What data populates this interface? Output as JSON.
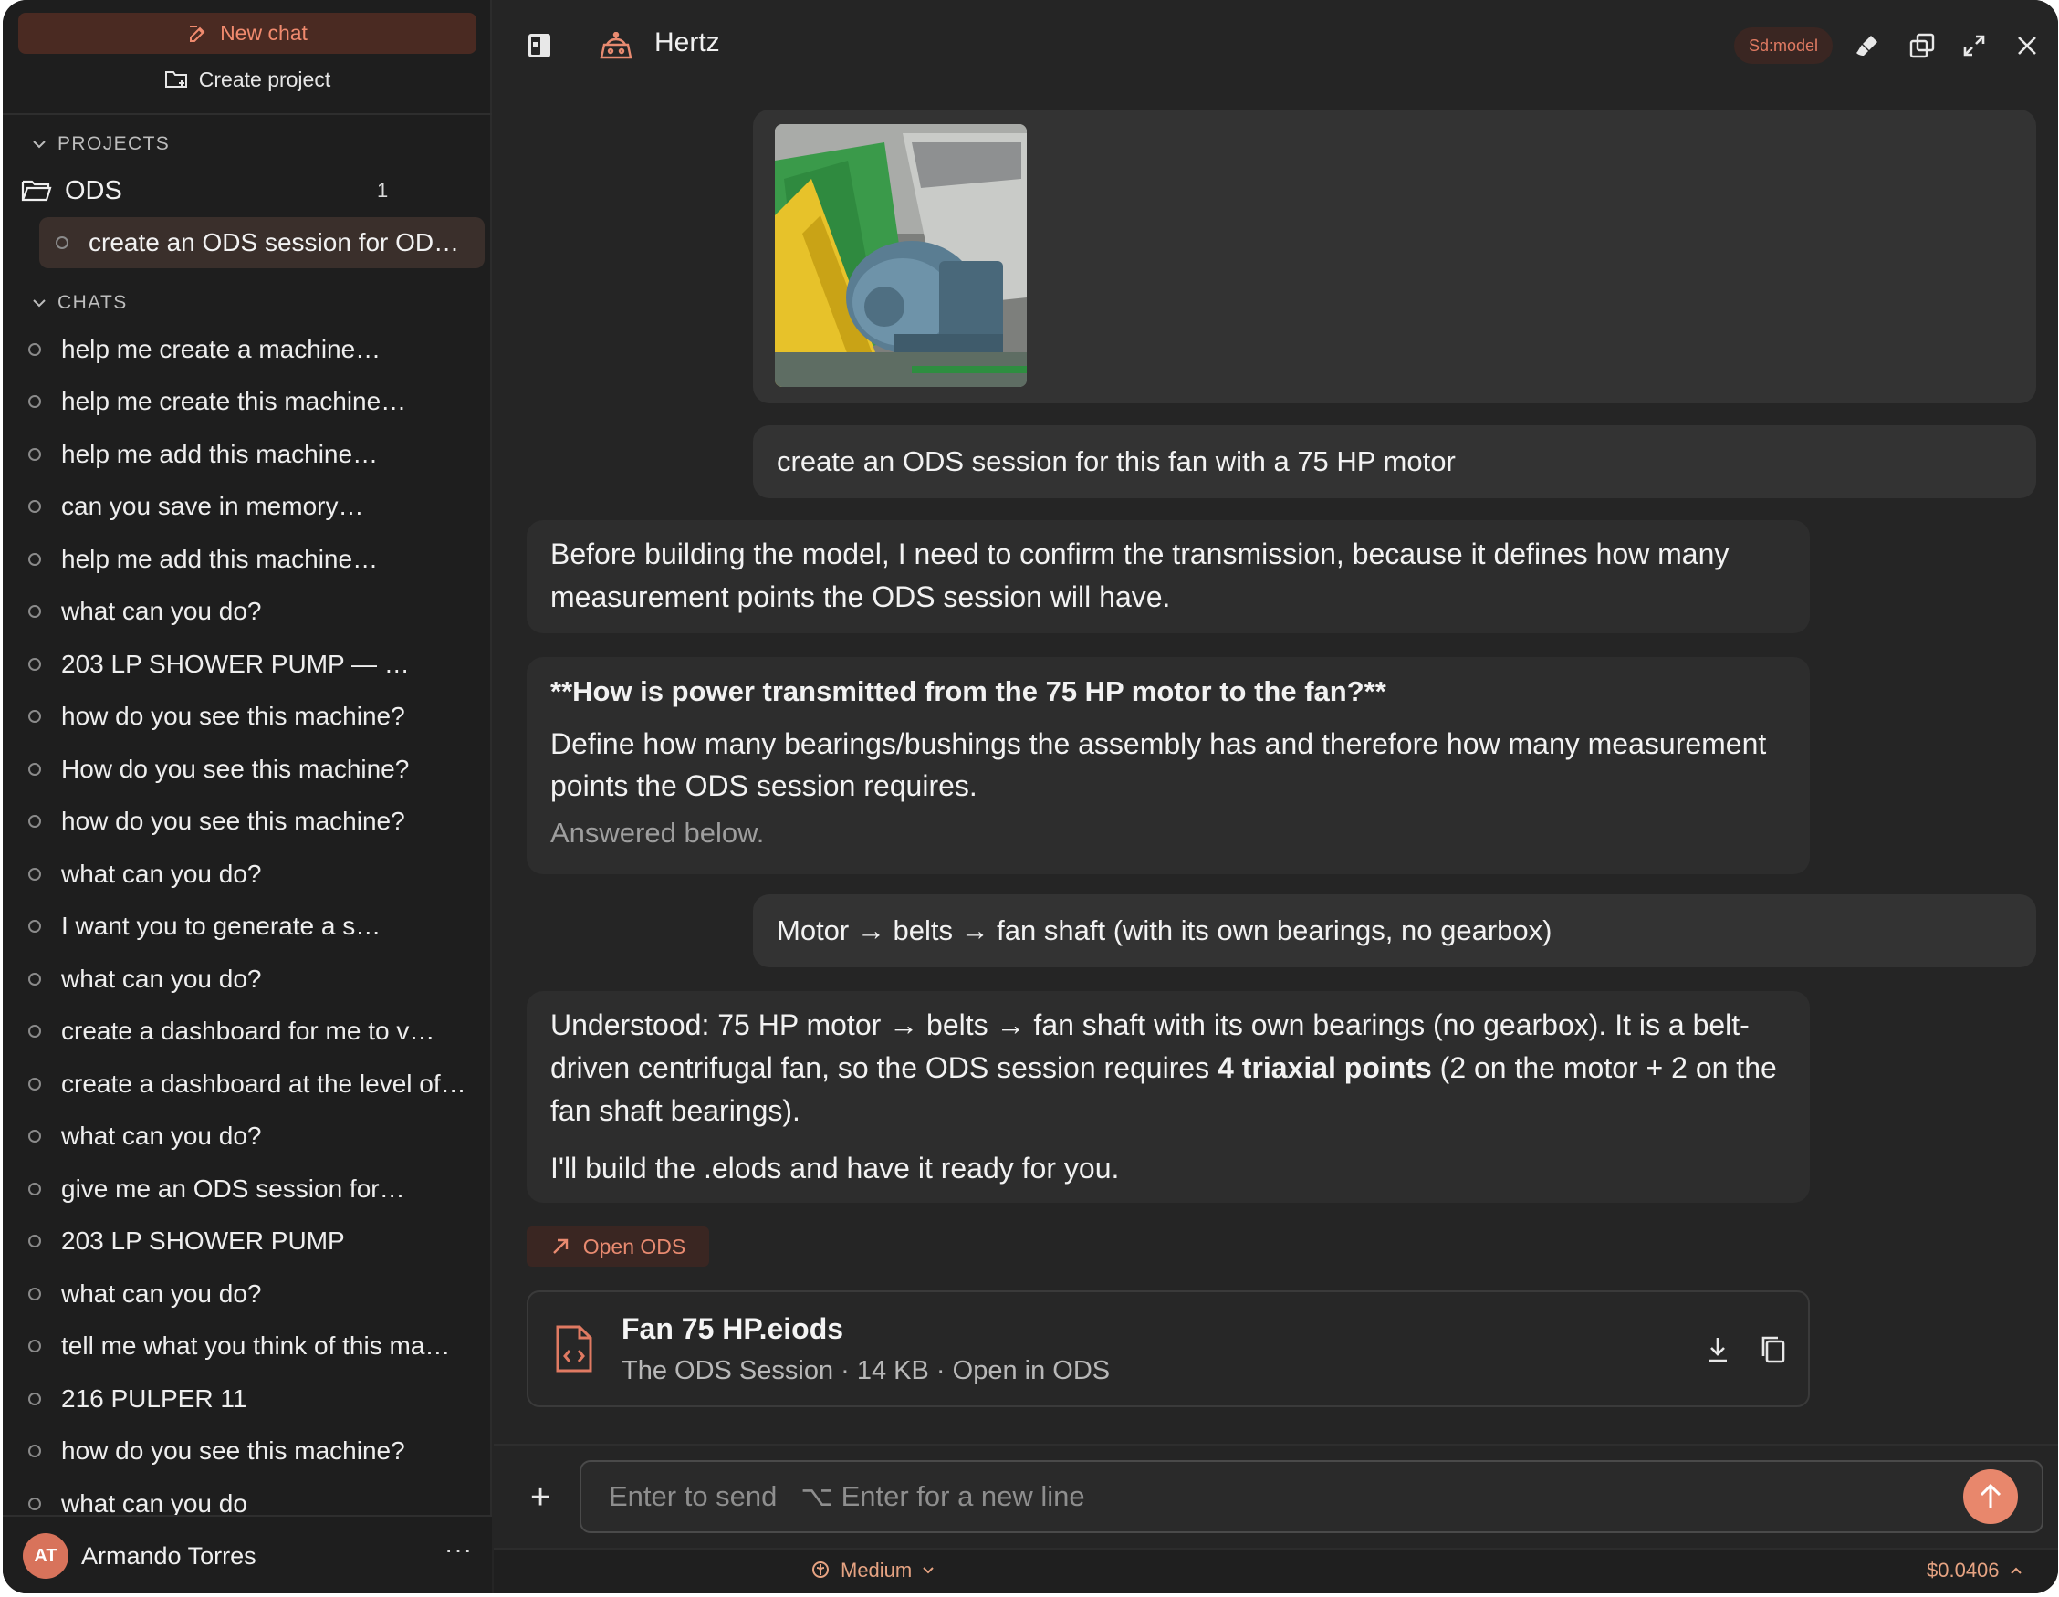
{
  "sidebar": {
    "new_chat": "New chat",
    "create_project": "Create project",
    "projects_heading": "PROJECTS",
    "project": {
      "name": "ODS",
      "count": "1",
      "chat": "create an ODS session for OD…"
    },
    "chats_heading": "CHATS",
    "chats": [
      "help me create a machine…",
      "help me create this machine…",
      "help me add this machine…",
      "can you save in memory…",
      "help me add this machine…",
      "what can you do?",
      "203 LP SHOWER PUMP — …",
      "how do you see this machine?",
      "How do you see this machine?",
      "how do you see this machine?",
      "what can you do?",
      "I want you to generate a s…",
      "what can you do?",
      "create a dashboard for me to v…",
      "create a dashboard at the level of…",
      "what can you do?",
      "give me an ODS session for…",
      "203 LP SHOWER PUMP",
      "what can you do?",
      "tell me what you think of this ma…",
      "216 PULPER 11",
      "how do you see this machine?",
      "what can you do"
    ],
    "user": {
      "initials": "AT",
      "name": "Armando Torres",
      "more": "···"
    }
  },
  "header": {
    "title": "Hertz",
    "model_badge": "Sd:model"
  },
  "messages": {
    "user1": "create an ODS session for this fan with a 75 HP motor",
    "ai1": "Before building the model, I need to confirm the transmission, because it defines how many measurement points the ODS session will have.",
    "question_title": "**How is power transmitted from the 75 HP motor to the fan?**",
    "question_body": "Define how many bearings/bushings the assembly has and therefore how many measurement points the ODS session requires.",
    "question_status": "Answered below.",
    "user2": "Motor → belts → fan shaft (with its own bearings, no gearbox)",
    "ai2_part1": "Understood: 75 HP motor → belts → fan shaft with its own bearings (no gearbox). It is a belt-driven centrifugal fan, so the ODS session requires ",
    "ai2_bold": "4 triaxial points",
    "ai2_part2": " (2 on the motor + 2 on the fan shaft bearings).",
    "ai2_line2": "I'll build the .elods and have it ready for you."
  },
  "actions": {
    "open_ods": "Open ODS"
  },
  "file": {
    "name": "Fan 75 HP.eiods",
    "meta": "The ODS Session · 14 KB · Open in ODS"
  },
  "composer": {
    "placeholder": "Enter to send   ⌥ Enter for a new line"
  },
  "footer": {
    "effort": "Medium",
    "cost": "$0.0406"
  },
  "colors": {
    "accent": "#e8876c",
    "accent_dark": "#3a2622",
    "background": "#252525",
    "sidebar": "#1e1e1e"
  }
}
